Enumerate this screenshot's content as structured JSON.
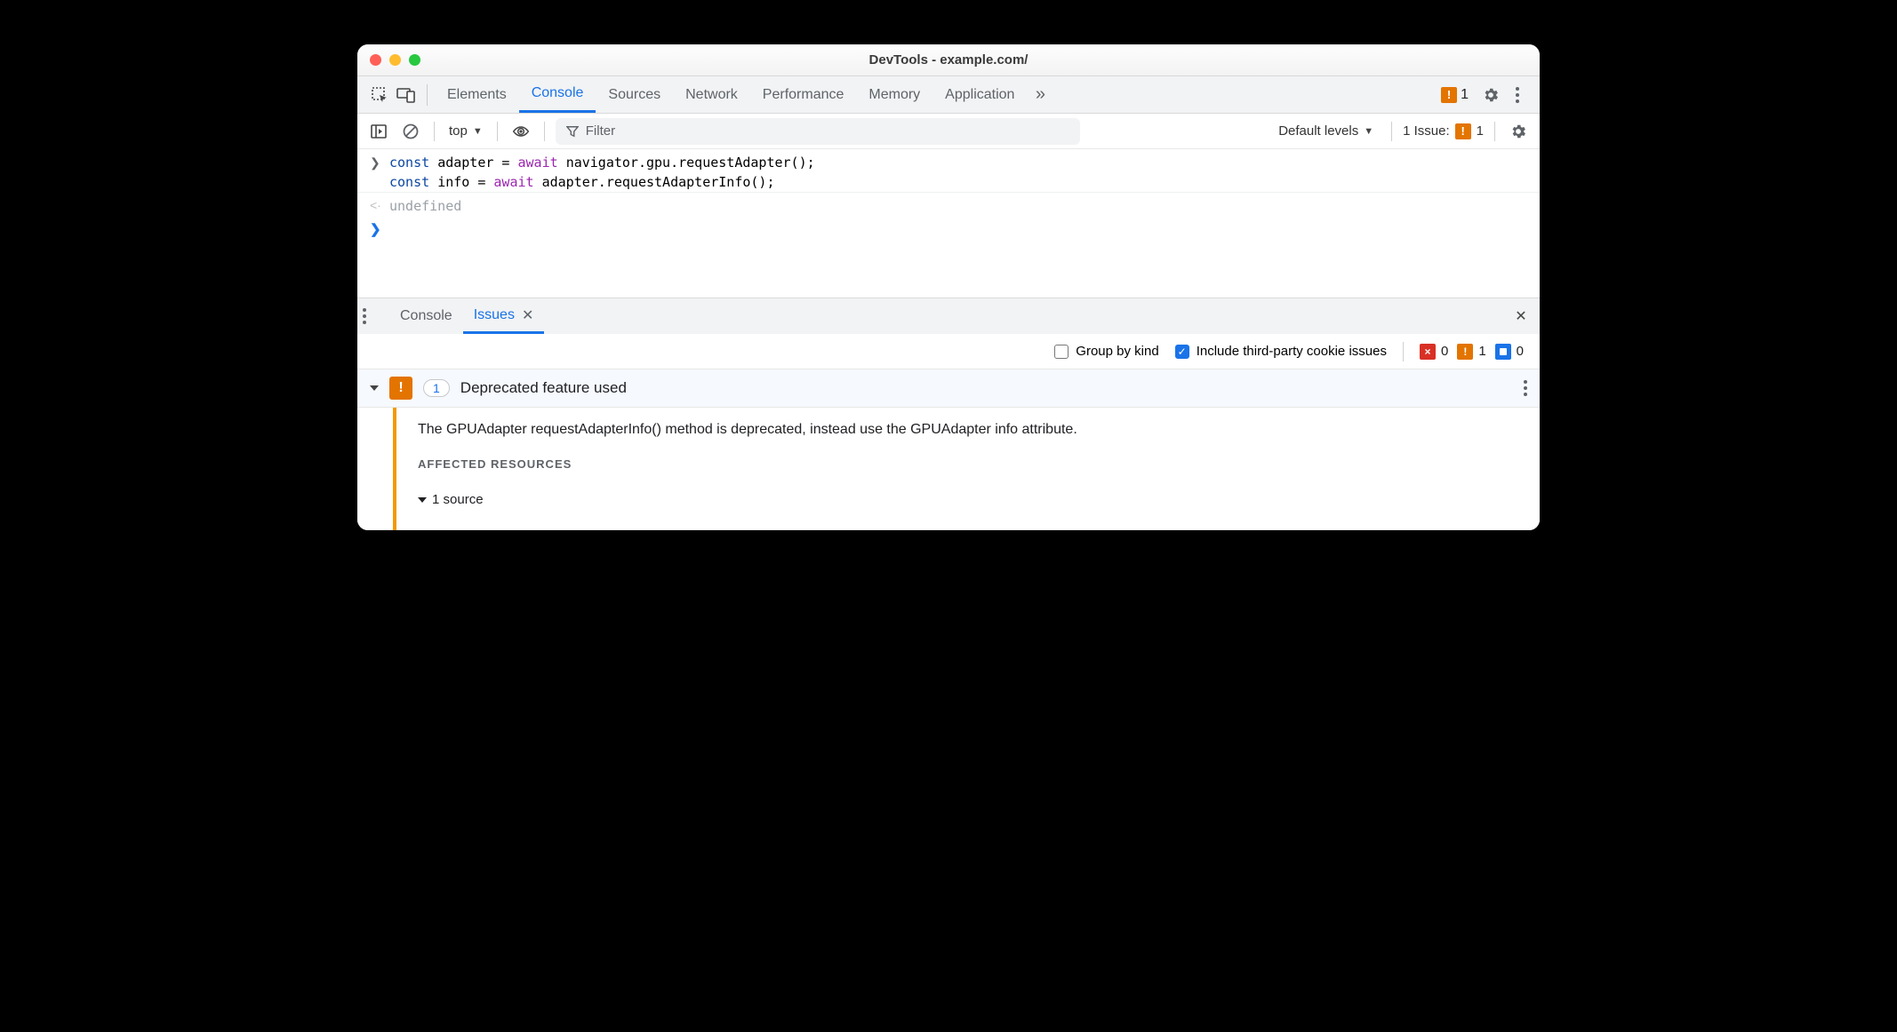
{
  "window": {
    "title": "DevTools - example.com/"
  },
  "tabs": {
    "items": [
      "Elements",
      "Console",
      "Sources",
      "Network",
      "Performance",
      "Memory",
      "Application"
    ],
    "active": "Console",
    "overflow_icon": "chevrons-right",
    "issue_count": "1"
  },
  "console_toolbar": {
    "context": "top",
    "filter_placeholder": "Filter",
    "levels_label": "Default levels",
    "issues_label": "1 Issue:",
    "issues_count": "1"
  },
  "console": {
    "input_lines": [
      {
        "segments": [
          {
            "t": "const ",
            "c": "kw2"
          },
          {
            "t": "adapter = "
          },
          {
            "t": "await ",
            "c": "kw"
          },
          {
            "t": "navigator.gpu.requestAdapter();"
          }
        ]
      },
      {
        "segments": [
          {
            "t": "const ",
            "c": "kw2"
          },
          {
            "t": "info = "
          },
          {
            "t": "await ",
            "c": "kw"
          },
          {
            "t": "adapter.requestAdapterInfo();"
          }
        ]
      }
    ],
    "output": "undefined"
  },
  "drawer": {
    "tabs": [
      "Console",
      "Issues"
    ],
    "active": "Issues",
    "group_by_kind": {
      "label": "Group by kind",
      "checked": false
    },
    "third_party": {
      "label": "Include third-party cookie issues",
      "checked": true
    },
    "severity": {
      "errors": "0",
      "warnings": "1",
      "info": "0"
    }
  },
  "issue": {
    "count": "1",
    "title": "Deprecated feature used",
    "message": "The GPUAdapter requestAdapterInfo() method is deprecated, instead use the GPUAdapter info attribute.",
    "affected_label": "AFFECTED RESOURCES",
    "sources_label": "1 source"
  }
}
